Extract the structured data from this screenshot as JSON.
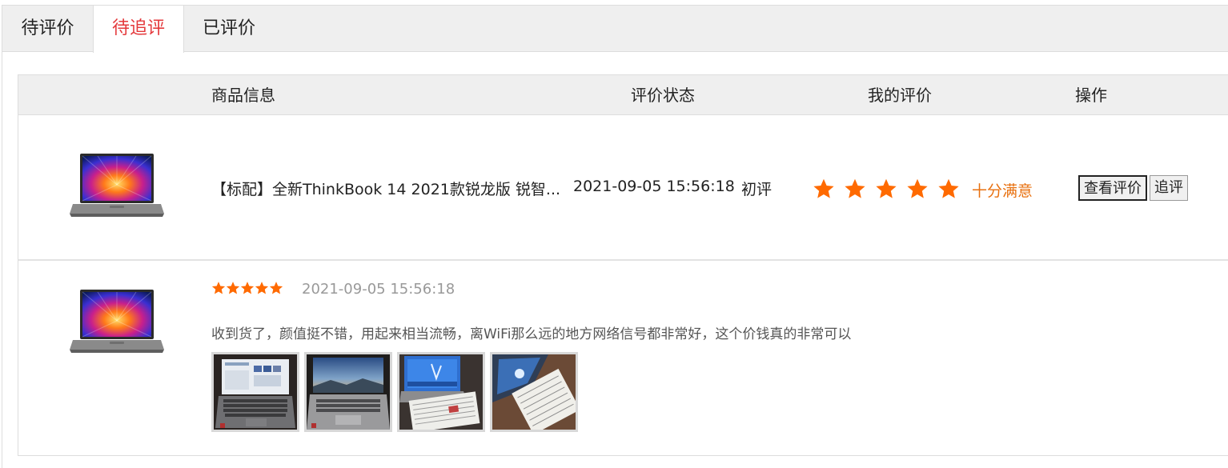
{
  "tabs": [
    {
      "label": "待评价"
    },
    {
      "label": "待追评",
      "active": true
    },
    {
      "label": "已评价"
    }
  ],
  "table": {
    "headers": {
      "goods": "商品信息",
      "status": "评价状态",
      "mine": "我的评价",
      "op": "操作"
    },
    "order": {
      "product_image": "laptop-thinkbook-icon",
      "product_name": "【标配】全新ThinkBook 14 2021款锐龙版 锐智...",
      "review_time": "2021-09-05 15:56:18",
      "review_type": "初评",
      "rating_stars": 5,
      "rating_text": "十分满意",
      "actions": {
        "view_label": "查看评价",
        "follow_label": "追评"
      }
    },
    "review": {
      "product_image": "laptop-thinkbook-icon",
      "rating_stars": 5,
      "time": "2021-09-05 15:56:18",
      "comment": "收到货了，颜值挺不错，用起来相当流畅，离WiFi那么远的地方网络信号都非常好，这个价钱真的非常可以",
      "photos": [
        {
          "name": "review-photo-1"
        },
        {
          "name": "review-photo-2"
        },
        {
          "name": "review-photo-3"
        },
        {
          "name": "review-photo-4"
        }
      ]
    }
  },
  "colors": {
    "accent_tab": "#e4393c",
    "star": "#ff6a00",
    "rating_text": "#e8700f",
    "header_bg": "#efefef"
  }
}
